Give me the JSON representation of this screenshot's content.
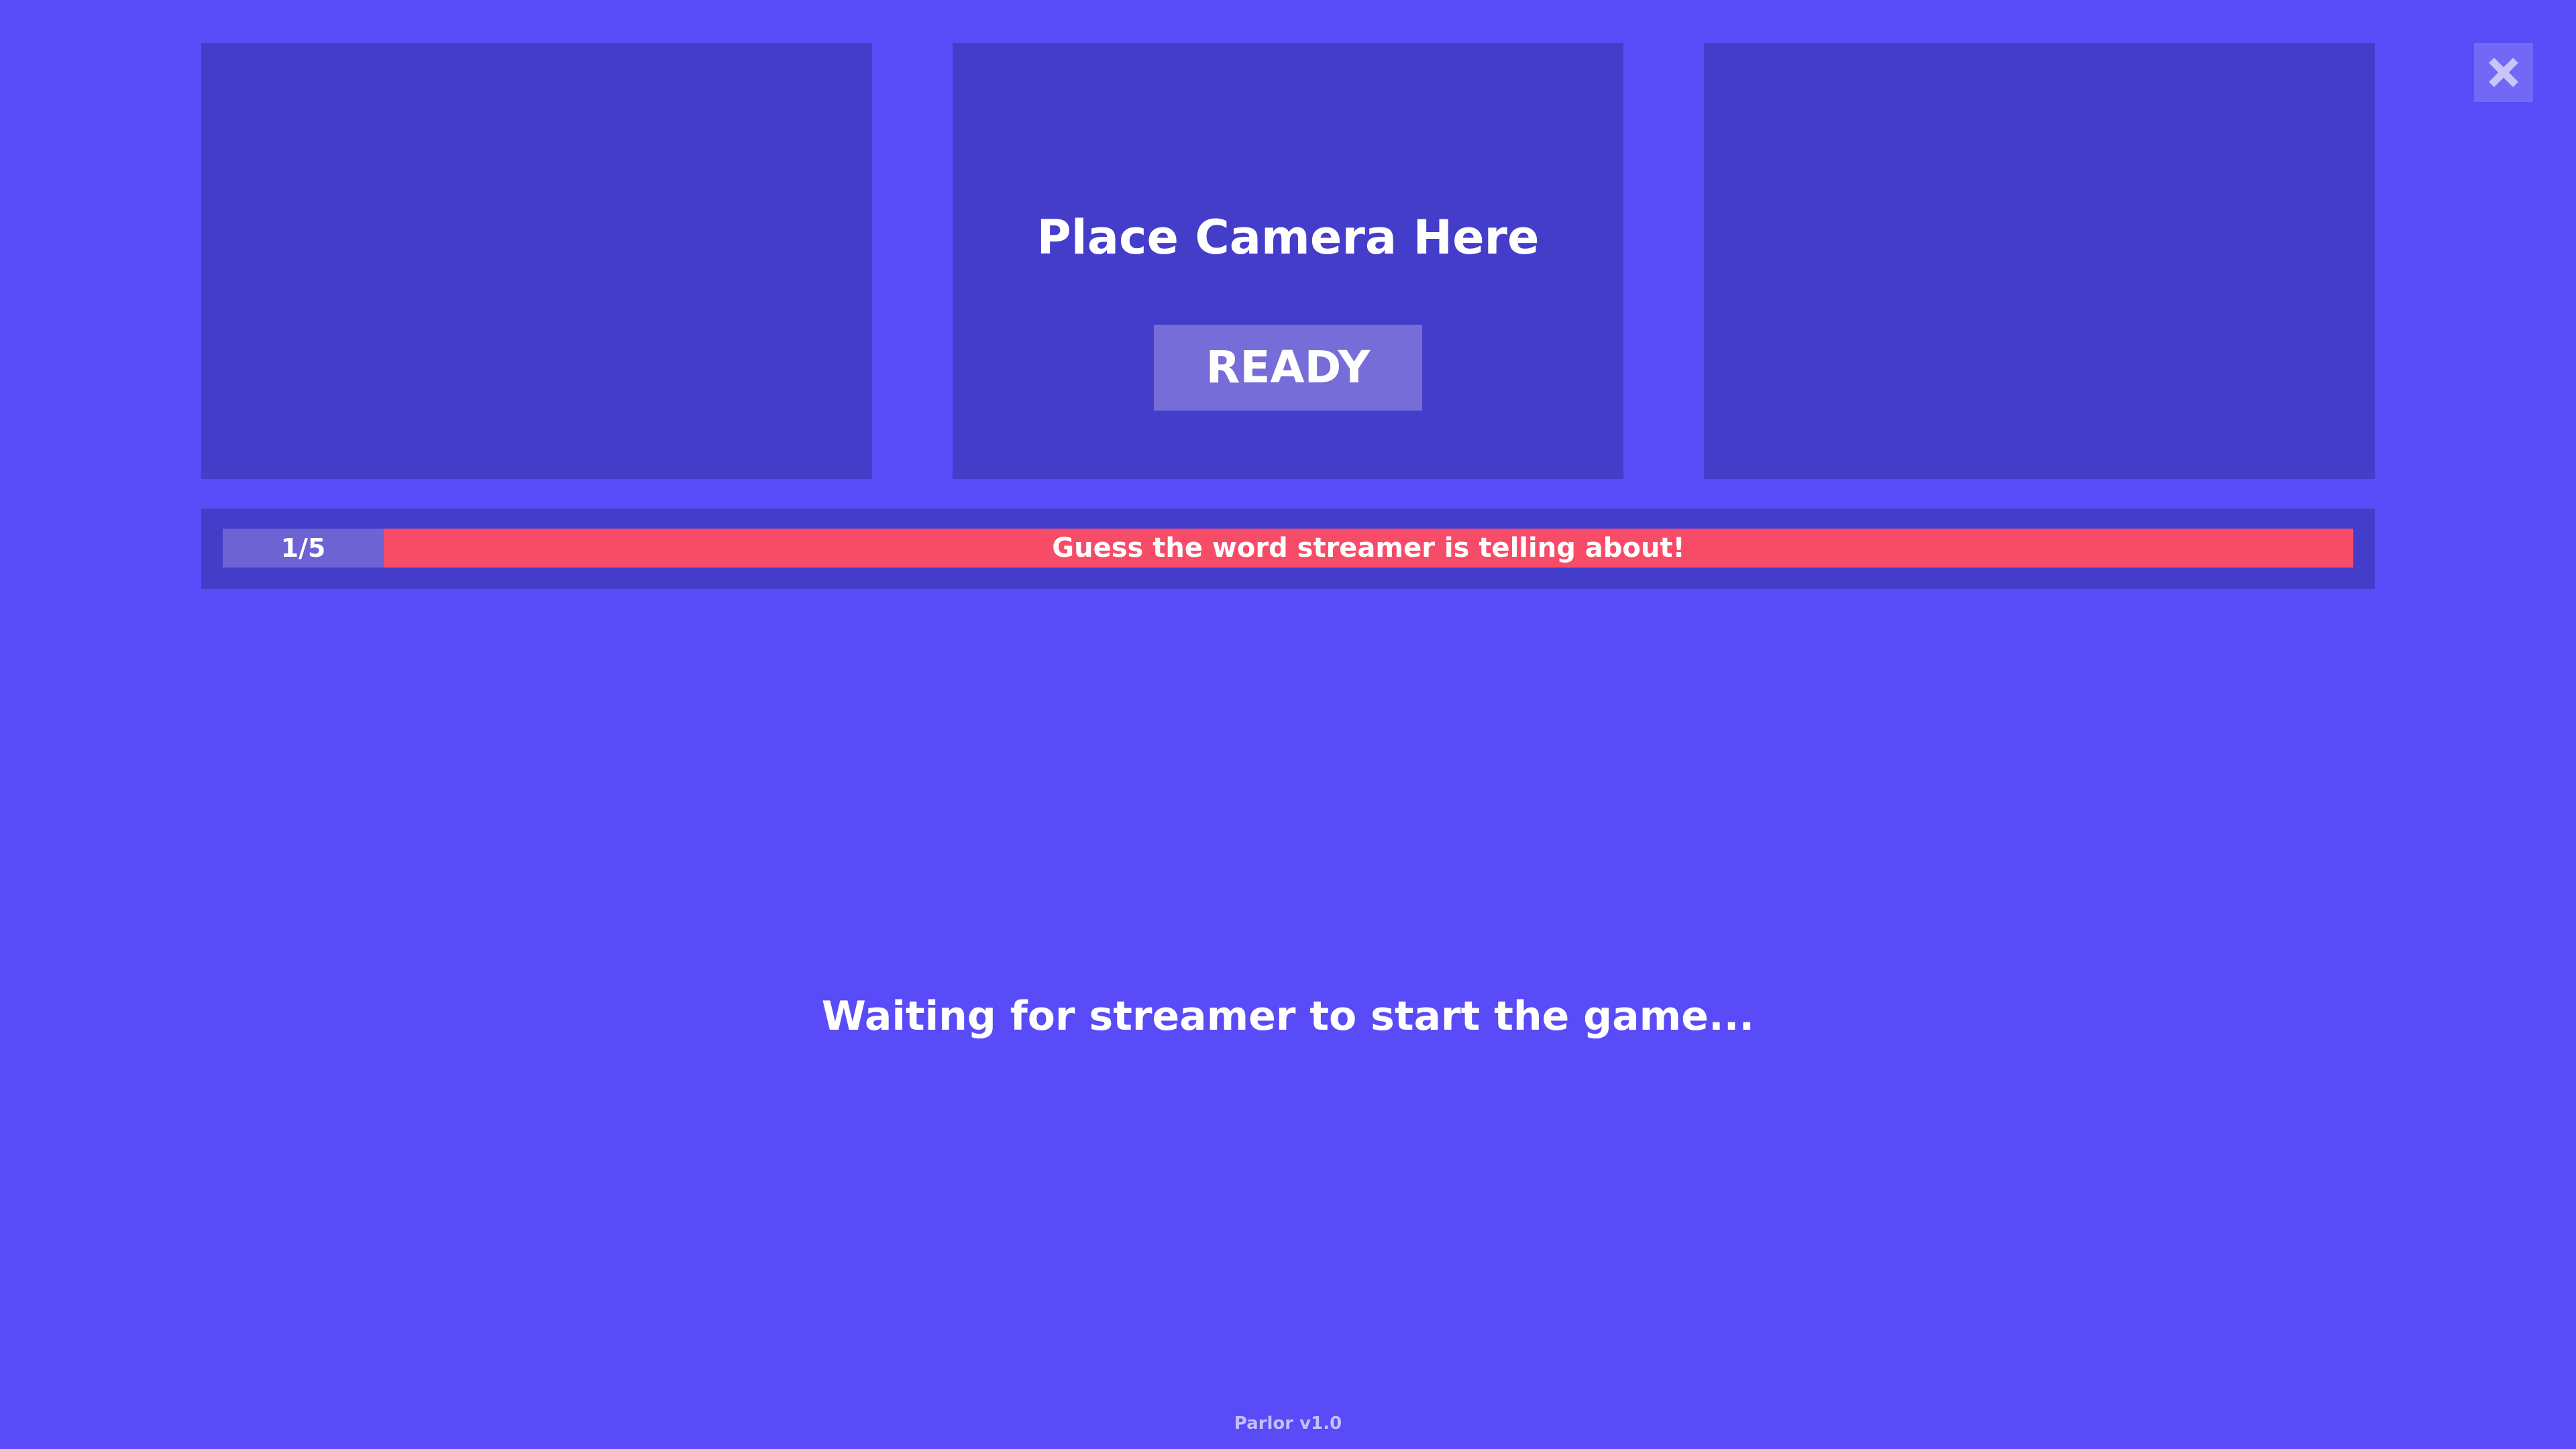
{
  "camera_panel": {
    "title": "Place Camera Here",
    "ready_label": "READY"
  },
  "close_button": {
    "icon": "close-icon"
  },
  "info_bar": {
    "round": "1/5",
    "prompt": "Guess the word streamer is telling about!"
  },
  "status": {
    "message": "Waiting for streamer to start the game..."
  },
  "footer": {
    "version": "Parlor v1.0"
  },
  "colors": {
    "background": "#594bf7",
    "panel": "#443dc9",
    "button": "#776dd8",
    "round_counter": "#6d63d3",
    "prompt_bar": "#f74c68",
    "close_button": "#7169f5"
  }
}
